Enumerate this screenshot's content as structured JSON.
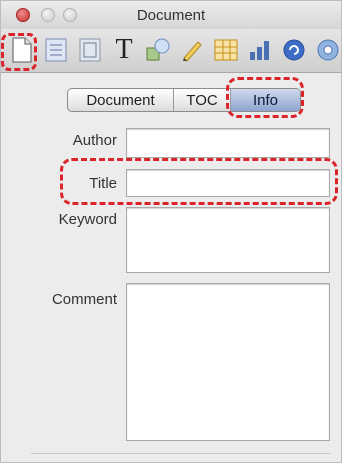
{
  "window": {
    "title": "Document"
  },
  "toolbar": {
    "icons": [
      "document-icon",
      "list-icon",
      "layout-icon",
      "text-icon",
      "shapes-icon",
      "pen-icon",
      "table-icon",
      "chart-icon",
      "comment-icon",
      "media-icon"
    ],
    "text_glyph": "T"
  },
  "tabs": [
    {
      "label": "Document",
      "selected": false
    },
    {
      "label": "TOC",
      "selected": false
    },
    {
      "label": "Info",
      "selected": true
    }
  ],
  "form": {
    "author": {
      "label": "Author",
      "value": ""
    },
    "title": {
      "label": "Title",
      "value": ""
    },
    "keyword": {
      "label": "Keyword",
      "value": ""
    },
    "comment": {
      "label": "Comment",
      "value": ""
    }
  },
  "colors": {
    "highlight": "#d9252a",
    "selected_tab": "#8ea4cf"
  }
}
